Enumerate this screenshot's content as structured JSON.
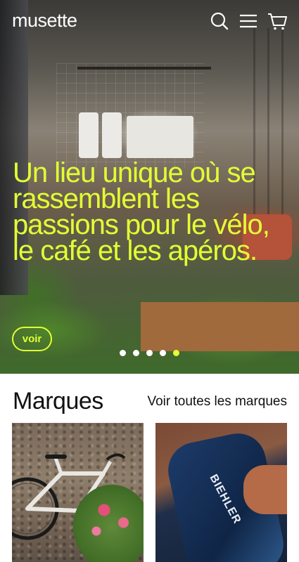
{
  "header": {
    "logo": "musette",
    "icons": {
      "search": "search-icon",
      "menu": "menu-icon",
      "cart": "cart-icon"
    }
  },
  "hero": {
    "headline": "Un lieu unique où se rassemblent les passions pour le vélo, le café et les apéros.",
    "button_label": "voir",
    "slide_count": 5,
    "active_slide": 5,
    "accent_color": "#e2ff34"
  },
  "brands": {
    "title": "Marques",
    "link_label": "Voir toutes les marques",
    "cards": [
      {
        "image": "road-bike-with-flowers"
      },
      {
        "image": "cyclist-in-jersey",
        "print": "BIEHLER"
      }
    ]
  }
}
